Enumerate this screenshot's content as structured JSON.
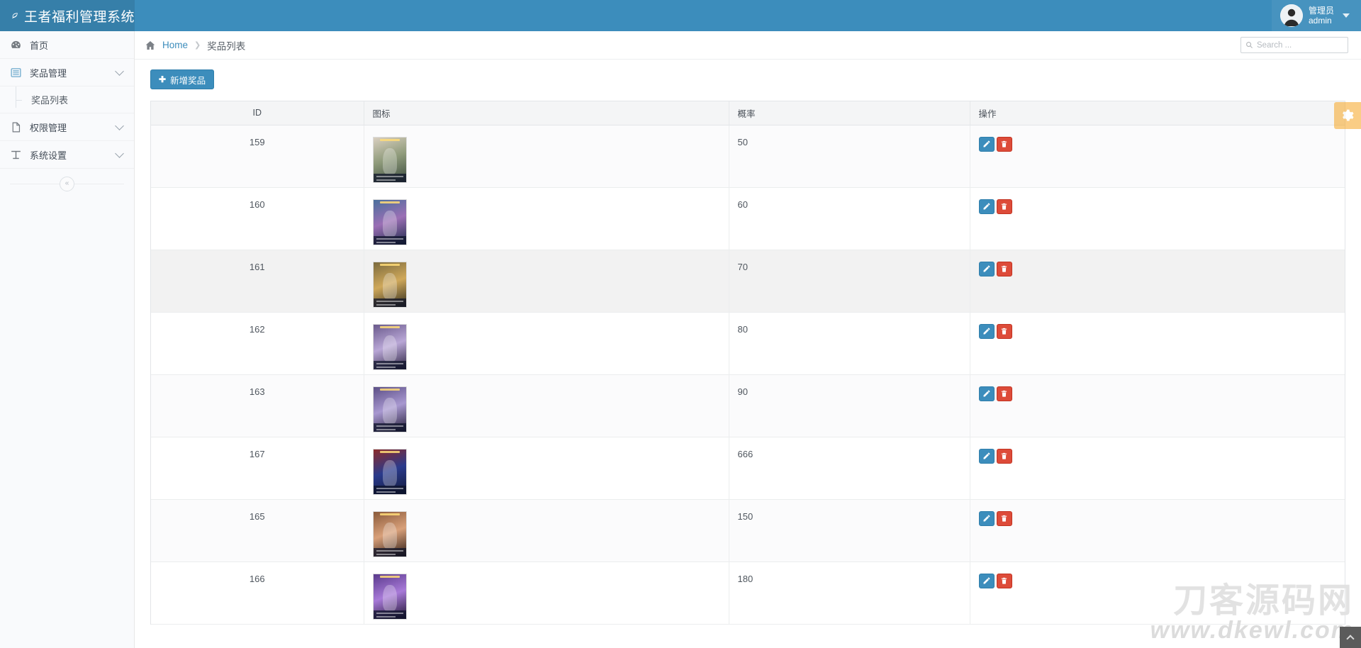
{
  "app": {
    "title": "王者福利管理系统",
    "logo_icon": "leaf-icon"
  },
  "topbar": {
    "user_role": "管理员",
    "user_name": "admin",
    "avatar_icon": "user-avatar-icon",
    "caret_icon": "chevron-down-icon"
  },
  "sidebar": {
    "items": [
      {
        "label": "首页",
        "icon": "dashboard-icon",
        "expandable": false
      },
      {
        "label": "奖品管理",
        "icon": "list-icon",
        "expandable": true
      },
      {
        "label": "权限管理",
        "icon": "file-icon",
        "expandable": true
      },
      {
        "label": "系统设置",
        "icon": "text-tool-icon",
        "expandable": true
      }
    ],
    "submenu": [
      {
        "label": "奖品列表",
        "parent": "奖品管理"
      }
    ],
    "collapse_icon": "chevron-left-double-icon",
    "collapse_glyph": "«"
  },
  "breadcrumb": {
    "home_icon": "home-icon",
    "home_label": "Home",
    "separator": "❯",
    "current": "奖品列表"
  },
  "search": {
    "icon": "search-icon",
    "placeholder": "Search ...",
    "value": ""
  },
  "toolbar": {
    "add_label": "新增奖品",
    "add_icon": "plus-icon"
  },
  "table": {
    "columns": [
      "ID",
      "图标",
      "概率",
      "操作"
    ],
    "rows": [
      {
        "id": "159",
        "rate": "50",
        "icon_alt": "prize-thumbnail",
        "shaded": false
      },
      {
        "id": "160",
        "rate": "60",
        "icon_alt": "prize-thumbnail",
        "shaded": false
      },
      {
        "id": "161",
        "rate": "70",
        "icon_alt": "prize-thumbnail",
        "shaded": true
      },
      {
        "id": "162",
        "rate": "80",
        "icon_alt": "prize-thumbnail",
        "shaded": false
      },
      {
        "id": "163",
        "rate": "90",
        "icon_alt": "prize-thumbnail",
        "shaded": false
      },
      {
        "id": "167",
        "rate": "666",
        "icon_alt": "prize-thumbnail",
        "shaded": false
      },
      {
        "id": "165",
        "rate": "150",
        "icon_alt": "prize-thumbnail",
        "shaded": false
      },
      {
        "id": "166",
        "rate": "180",
        "icon_alt": "prize-thumbnail",
        "shaded": false
      }
    ],
    "actions": {
      "edit_icon": "edit-pencil-icon",
      "delete_icon": "trash-icon"
    }
  },
  "floating": {
    "settings_icon": "gear-icon",
    "scroll_top_icon": "chevron-up-icon"
  },
  "watermark": {
    "line1": "刀客源码网",
    "line2": "www.dkewl.com"
  },
  "colors": {
    "brand": "#3c8dbc",
    "brand_dark": "#367fa9",
    "danger": "#dd4b39",
    "accent_orange": "#f6a623",
    "sidebar_bg": "#f9fafc"
  },
  "thumbnails": [
    {
      "c1": "#d9cfc0",
      "c2": "#8e9a7a",
      "c3": "#3a4a3e"
    },
    {
      "c1": "#4a6f9c",
      "c2": "#9b6fb5",
      "c3": "#1d2a4a"
    },
    {
      "c1": "#7b6a3e",
      "c2": "#cfa85a",
      "c3": "#2e2a1c"
    },
    {
      "c1": "#6a5a8c",
      "c2": "#b9a7d6",
      "c3": "#2b2340"
    },
    {
      "c1": "#5c4f86",
      "c2": "#a898d0",
      "c3": "#241e38"
    },
    {
      "c1": "#8c2a2a",
      "c2": "#2a3a8c",
      "c3": "#121a3a"
    },
    {
      "c1": "#8a5a3a",
      "c2": "#d8a07a",
      "c3": "#2a1a14"
    },
    {
      "c1": "#5a3a8c",
      "c2": "#a87ad8",
      "c3": "#1e1230"
    }
  ]
}
